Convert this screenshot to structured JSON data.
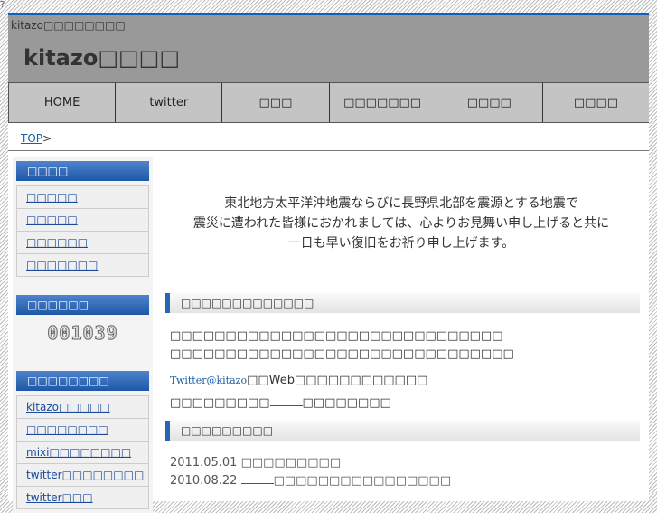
{
  "corner": "?",
  "header": {
    "subtitle": "kitazo□□□□□□□□",
    "title": "kitazo□□□□"
  },
  "nav": [
    "HOME",
    "twitter",
    "□□□",
    "□□□□□□□",
    "□□□□",
    "□□□□"
  ],
  "breadcrumb": {
    "top": "TOP",
    "sep": ">"
  },
  "sidebar": {
    "menu": {
      "heading": "□□□□",
      "items": [
        "□□□□□",
        "□□□□□",
        "□□□□□□",
        "□□□□□□□"
      ]
    },
    "counter": {
      "heading": "□□□□□□",
      "value": "001039"
    },
    "links": {
      "heading": "□□□□□□□□",
      "items": [
        "kitazo□□□□□",
        "□□□□□□□□",
        "mixi□□□□□□□□",
        "twitter□□□□□□□□",
        "twitter□□□"
      ]
    }
  },
  "main": {
    "message": [
      "東北地方太平洋沖地震ならびに長野県北部を震源とする地震で",
      "震災に遭われた皆様におかれましては、心よりお見舞い申し上げると共に",
      "一日も早い復旧をお祈り申し上げます。"
    ],
    "section1": {
      "heading": "□□□□□□□□□□□□□",
      "line1": "□□□□□□□□□□□□□□□□□□□□□□□□□□□□□□",
      "line2": "□□□□□□□□□□□□□□□□□□□□□□□□□□□□□□□",
      "twitter_link": "Twitter@kitazo",
      "twitter_rest": "□□Web□□□□□□□□□□□□",
      "line4_a": "□□□□□□□□□",
      "line4_b": "□□□□□□□□"
    },
    "section2": {
      "heading": "□□□□□□□□□",
      "news": [
        {
          "date": "2011.05.01",
          "text": "□□□□□□□□□"
        },
        {
          "date": "2010.08.22",
          "text": "□□□□□□□□□□□□□□□□"
        }
      ]
    }
  }
}
